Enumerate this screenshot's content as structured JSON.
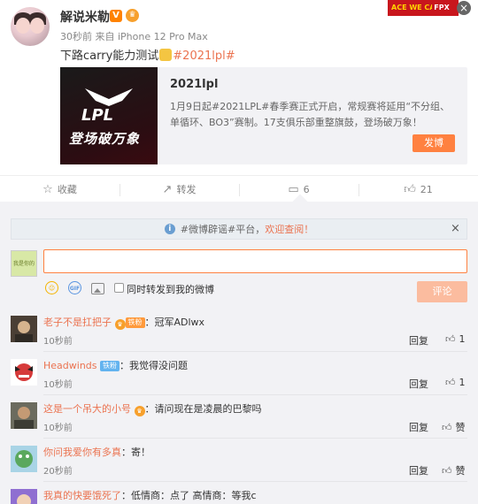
{
  "post": {
    "username": "解说米勒",
    "vip_badge": "V",
    "meta": "30秒前 来自 iPhone 12 Pro Max",
    "text_before": "下路carry能力测试",
    "hashtag": "#2021lpl#",
    "banner_text": "ACE WE CAN",
    "banner_logo": "FPX"
  },
  "card": {
    "title": "2021lpl",
    "description": "1月9日起#2021LPL#春季赛正式开启，常规赛将延用“不分组、单循环、BO3”赛制。17支俱乐部重整旗鼓，登场破万象！",
    "button": "发博",
    "image_logo": "LPL",
    "image_slogan": "登场破万象"
  },
  "actions": {
    "favorite": "收藏",
    "repost": "转发",
    "comment_count": "6",
    "like_count": "21"
  },
  "comment_box": {
    "notice_text": "#微博辟谣#平台，",
    "notice_link": "欢迎查阅！",
    "my_avatar_text": "我是你的鲨鱼",
    "repost_label": "同时转发到我的微博",
    "submit": "评论",
    "gif_label": "GIF"
  },
  "comments": [
    {
      "name": "老子不是扛把子",
      "badge": "铁粉",
      "text": "：冠军ADlwx",
      "time": "10秒前",
      "reply": "回复",
      "likes": "1"
    },
    {
      "name": "Headwinds",
      "badge": "铁粉",
      "text": "：我觉得没问题",
      "time": "10秒前",
      "reply": "回复",
      "likes": "1"
    },
    {
      "name": "这是一个吊大的小号",
      "badge": "",
      "text": "：请问现在是凌晨的巴黎吗",
      "time": "10秒前",
      "reply": "回复",
      "likes": "赞"
    },
    {
      "name": "你问我爱你有多真",
      "badge": "",
      "text": "：寄！",
      "time": "20秒前",
      "reply": "回复",
      "likes": "赞"
    },
    {
      "name": "我真的快要饿死了",
      "badge": "",
      "text": "：低情商：点了 高情商：等我c",
      "time": "",
      "reply": "",
      "likes": ""
    }
  ]
}
